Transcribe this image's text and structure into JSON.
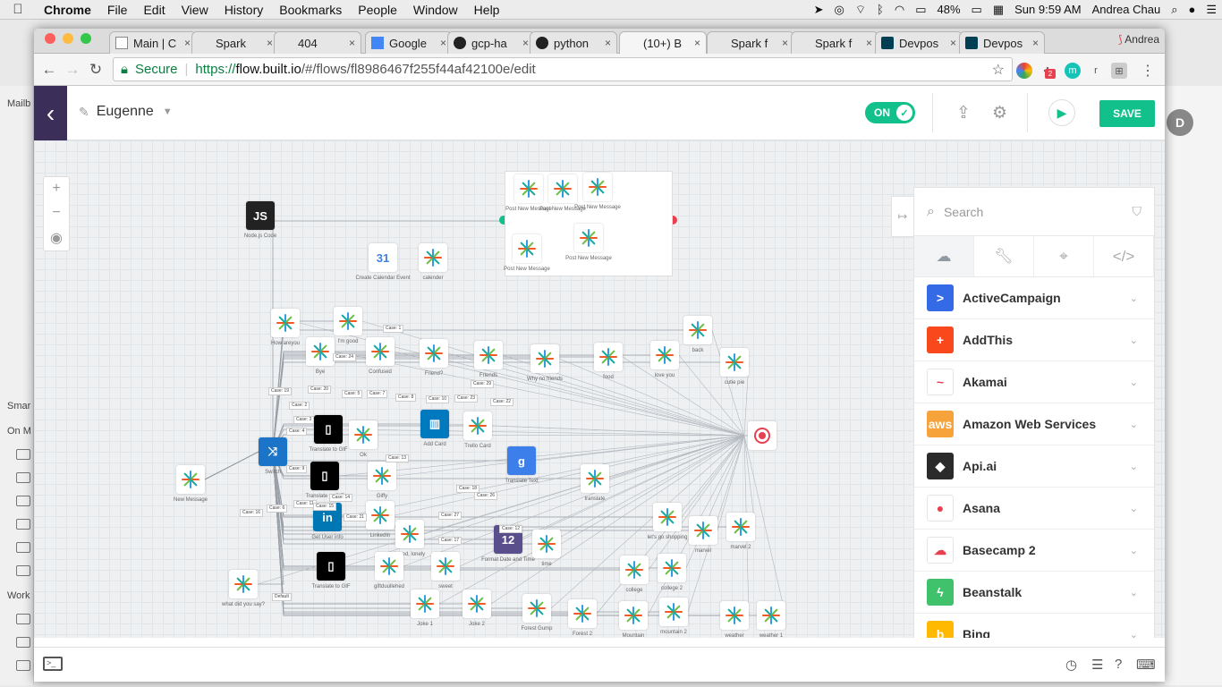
{
  "menubar": {
    "app": "Chrome",
    "items": [
      "File",
      "Edit",
      "View",
      "History",
      "Bookmarks",
      "People",
      "Window",
      "Help"
    ],
    "battery": "48%",
    "clock": "Sun 9:59 AM",
    "user": "Andrea Chau"
  },
  "browser": {
    "profile": "Andrea",
    "tabs": [
      {
        "title": "Main | C",
        "icon": "page-icon"
      },
      {
        "title": "Spark",
        "icon": "spark-icon"
      },
      {
        "title": "404",
        "icon": "spark-icon"
      },
      {
        "title": "Google",
        "icon": "docs-icon"
      },
      {
        "title": "gcp-ha",
        "icon": "github-icon"
      },
      {
        "title": "python",
        "icon": "github-icon"
      },
      {
        "title": "(10+) B",
        "icon": "builtio-icon",
        "active": true
      },
      {
        "title": "Spark f",
        "icon": "spark-icon"
      },
      {
        "title": "Spark f",
        "icon": "spark-icon"
      },
      {
        "title": "Devpos",
        "icon": "devpost-icon"
      },
      {
        "title": "Devpos",
        "icon": "devpost-icon"
      }
    ],
    "address": {
      "secure_label": "Secure",
      "scheme": "https://",
      "host": "flow.built.io",
      "path": "/#/flows/fl8986467f255f44af42100e/edit"
    },
    "ext_badge": "2"
  },
  "app": {
    "flow_name": "Eugenne",
    "toggle_label": "ON",
    "save_label": "SAVE",
    "colors": {
      "accent": "#11c08a",
      "back": "#3b2f5a",
      "end": "#e8404f"
    }
  },
  "canvas": {
    "nodes": [
      {
        "label": "Node.js Code"
      },
      {
        "label": "Create Calendar Event"
      },
      {
        "label": "calender"
      },
      {
        "label": "Post New Message"
      },
      {
        "label": "Post New Message"
      },
      {
        "label": "Post New Message"
      },
      {
        "label": "Post New Message"
      },
      {
        "label": "Post New Message"
      },
      {
        "label": "How areyou"
      },
      {
        "label": "I'm good"
      },
      {
        "label": "Bye"
      },
      {
        "label": "Confused"
      },
      {
        "label": "Friend?"
      },
      {
        "label": "Friends"
      },
      {
        "label": "Why no friends"
      },
      {
        "label": "food"
      },
      {
        "label": "love you"
      },
      {
        "label": "back"
      },
      {
        "label": "cutie pie"
      },
      {
        "label": "Translate to GIF"
      },
      {
        "label": "Ok"
      },
      {
        "label": "Add Card"
      },
      {
        "label": "Trello Card"
      },
      {
        "label": "Translate Text"
      },
      {
        "label": "translate"
      },
      {
        "label": "Switch"
      },
      {
        "label": "New Message"
      },
      {
        "label": "Translate to GIF"
      },
      {
        "label": "Giffy"
      },
      {
        "label": "Get User info"
      },
      {
        "label": "LinkedIn"
      },
      {
        "label": "bored, lonely"
      },
      {
        "label": "Format Date and Time"
      },
      {
        "label": "time"
      },
      {
        "label": "let's go shopping"
      },
      {
        "label": "marvel"
      },
      {
        "label": "marvel 2"
      },
      {
        "label": "Translate to GIF"
      },
      {
        "label": "giftduullehed"
      },
      {
        "label": "sweet"
      },
      {
        "label": "college"
      },
      {
        "label": "college 2"
      },
      {
        "label": "what did you say?"
      },
      {
        "label": "Joke 1"
      },
      {
        "label": "Joke 2"
      },
      {
        "label": "Forest Gump"
      },
      {
        "label": "Forest 2"
      },
      {
        "label": "Mountain"
      },
      {
        "label": "mountain 2"
      },
      {
        "label": "weather"
      },
      {
        "label": "weather 1"
      }
    ],
    "cases": [
      "Case: 1",
      "Case: 24",
      "Case: 19",
      "Case: 20",
      "Case: 5",
      "Case: 7",
      "Case: 8",
      "Case: 10",
      "Case: 23",
      "Case: 29",
      "Case: 22",
      "Case: 2",
      "Case: 4",
      "Case: 13",
      "Case: 9",
      "Case: 14",
      "Case: 18",
      "Case: 26",
      "Case: 11",
      "Case: 6",
      "Case: 21",
      "Case: 27",
      "Case: 17",
      "Case: 16",
      "Default",
      "Case: 15",
      "Case: 12",
      "Case: 3"
    ]
  },
  "panel": {
    "search_placeholder": "Search",
    "services": [
      {
        "name": "ActiveCampaign",
        "color": "#356ae6",
        "glyph": ">"
      },
      {
        "name": "AddThis",
        "color": "#f8481c",
        "glyph": "+"
      },
      {
        "name": "Akamai",
        "color": "#ffffff",
        "glyph": "~"
      },
      {
        "name": "Amazon Web Services",
        "color": "#f7a33b",
        "glyph": "aws"
      },
      {
        "name": "Api.ai",
        "color": "#2b2b2b",
        "glyph": "◆"
      },
      {
        "name": "Asana",
        "color": "#ffffff",
        "glyph": "●"
      },
      {
        "name": "Basecamp 2",
        "color": "#ffffff",
        "glyph": "☁"
      },
      {
        "name": "Beanstalk",
        "color": "#3fc26b",
        "glyph": "ϟ"
      },
      {
        "name": "Bing",
        "color": "#ffb900",
        "glyph": "b"
      }
    ]
  }
}
